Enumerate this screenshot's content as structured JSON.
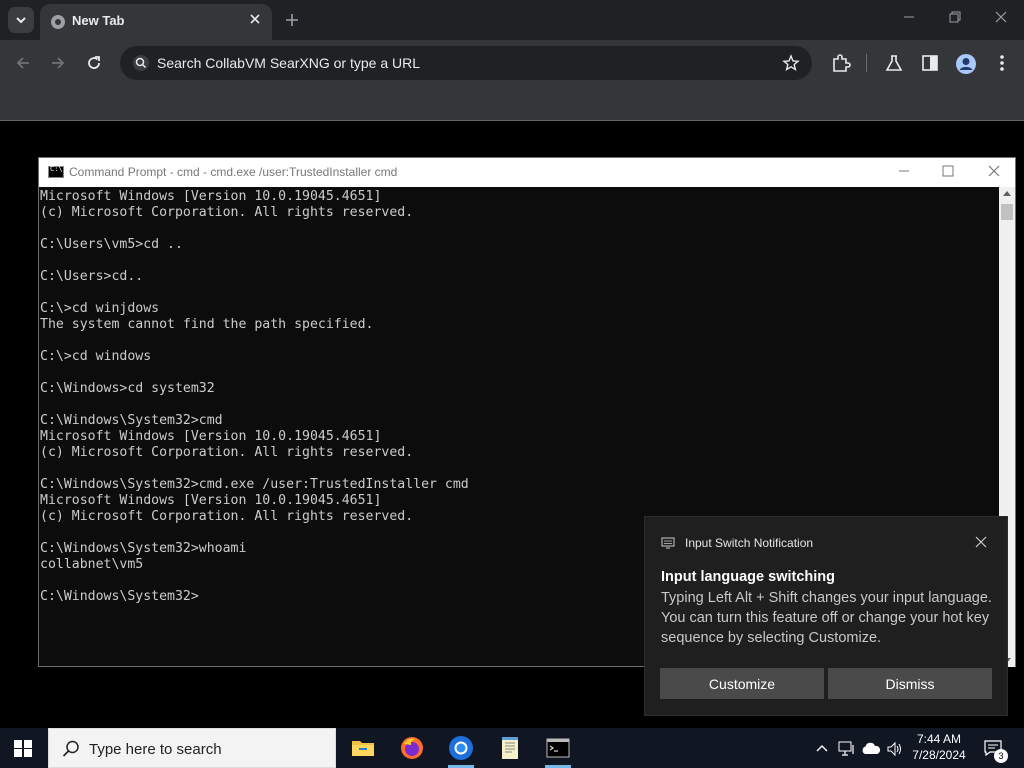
{
  "browser": {
    "tab_title": "New Tab",
    "omnibox_placeholder": "Search CollabVM SearXNG or type a URL"
  },
  "cmd": {
    "title": "Command Prompt - cmd - cmd.exe  /user:TrustedInstaller cmd",
    "lines": [
      "Microsoft Windows [Version 10.0.19045.4651]",
      "(c) Microsoft Corporation. All rights reserved.",
      "",
      "C:\\Users\\vm5>cd ..",
      "",
      "C:\\Users>cd..",
      "",
      "C:\\>cd winjdows",
      "The system cannot find the path specified.",
      "",
      "C:\\>cd windows",
      "",
      "C:\\Windows>cd system32",
      "",
      "C:\\Windows\\System32>cmd",
      "Microsoft Windows [Version 10.0.19045.4651]",
      "(c) Microsoft Corporation. All rights reserved.",
      "",
      "C:\\Windows\\System32>cmd.exe /user:TrustedInstaller cmd",
      "Microsoft Windows [Version 10.0.19045.4651]",
      "(c) Microsoft Corporation. All rights reserved.",
      "",
      "C:\\Windows\\System32>whoami",
      "collabnet\\vm5",
      "",
      "C:\\Windows\\System32>"
    ]
  },
  "toast": {
    "app_name": "Input Switch Notification",
    "heading": "Input language switching",
    "body": "Typing Left Alt + Shift changes your input language. You can turn this feature off or change your hot key sequence by selecting Customize.",
    "customize_label": "Customize",
    "dismiss_label": "Dismiss"
  },
  "taskbar": {
    "search_placeholder": "Type here to search",
    "time": "7:44 AM",
    "date": "7/28/2024",
    "notification_count": "3",
    "apps": [
      "file-explorer",
      "firefox",
      "chromium",
      "notepad",
      "command-prompt"
    ]
  },
  "colors": {
    "console_bg": "#0c0c0c",
    "console_text": "#cccccc",
    "taskbar_bg": "#101622",
    "browser_frame": "#202124",
    "browser_toolbar": "#35363a"
  }
}
